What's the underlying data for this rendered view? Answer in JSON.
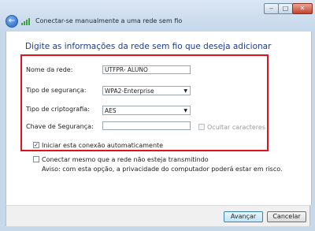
{
  "window": {
    "title": "Conectar-se manualmente a uma rede sem fio",
    "controls": {
      "minimize": "‒",
      "maximize": "□",
      "close": "✕"
    }
  },
  "heading": "Digite as informações da rede sem fio que deseja adicionar",
  "form": {
    "network_name_label": "Nome da rede:",
    "network_name_value": "UTFPR- ALUNO",
    "security_type_label": "Tipo de segurança:",
    "security_type_value": "WPA2-Enterprise",
    "encryption_type_label": "Tipo de criptografia:",
    "encryption_type_value": "AES",
    "security_key_label": "Chave de Segurança:",
    "security_key_value": "",
    "hide_chars_label": "Ocultar caracteres",
    "hide_chars_checked": false,
    "auto_start_label": "Iniciar esta conexão automaticamente",
    "auto_start_checked": true,
    "connect_hidden_label": "Conectar mesmo que a rede não esteja transmitindo",
    "connect_hidden_checked": false,
    "warning_text": "Aviso: com esta opção, a privacidade do computador poderá estar em risco."
  },
  "buttons": {
    "next": "Avançar",
    "cancel": "Cancelar"
  },
  "colors": {
    "highlight_box": "#e0121f",
    "heading": "#1f3d8c"
  },
  "icons": {
    "back": "back-arrow-icon",
    "wifi": "wireless-signal-icon"
  }
}
